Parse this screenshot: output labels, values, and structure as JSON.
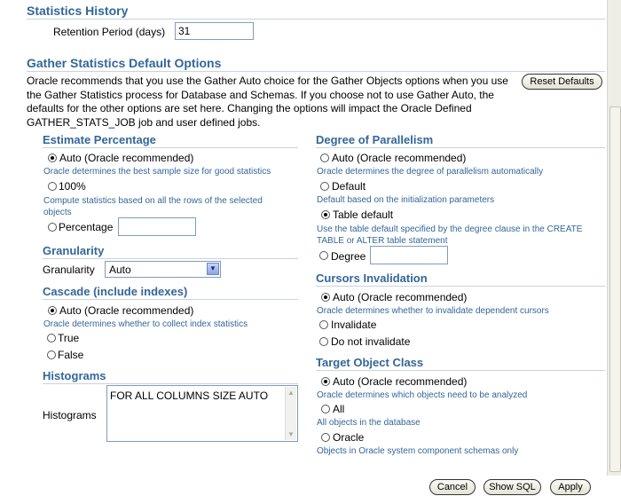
{
  "stats_history": {
    "title": "Statistics History",
    "retention_label": "Retention Period (days)",
    "retention_value": "31"
  },
  "gather_defaults": {
    "title": "Gather Statistics Default Options",
    "description_lines": [
      "Oracle recommends that you use the Gather Auto choice for the Gather Objects options when you use",
      "the Gather Statistics process for Database and Schemas. If you choose not to use Gather Auto, the",
      "defaults for the other options are set here. Changing the options will impact the Oracle Defined",
      "GATHER_STATS_JOB job and user defined jobs."
    ],
    "reset_button": "Reset Defaults"
  },
  "estimate": {
    "title": "Estimate Percentage",
    "auto_label": "Auto (Oracle recommended)",
    "auto_desc": "Oracle determines the best sample size for good statistics",
    "full_label": "100%",
    "full_desc_lines": [
      "Compute statistics based on all the rows of the selected",
      "objects"
    ],
    "pct_label": "Percentage",
    "pct_value": ""
  },
  "granularity": {
    "title": "Granularity",
    "label": "Granularity",
    "value": "Auto"
  },
  "cascade": {
    "title": "Cascade (include indexes)",
    "auto_label": "Auto (Oracle recommended)",
    "auto_desc": "Oracle determines whether to collect index statistics",
    "true_label": "True",
    "false_label": "False"
  },
  "histograms": {
    "title": "Histograms",
    "label": "Histograms",
    "value": "FOR ALL COLUMNS SIZE AUTO"
  },
  "parallelism": {
    "title": "Degree of Parallelism",
    "auto_label": "Auto (Oracle recommended)",
    "auto_desc": "Oracle determines the degree of parallelism automatically",
    "default_label": "Default",
    "default_desc": "Default based on the initialization parameters",
    "table_label": "Table default",
    "table_desc_lines": [
      "Use the table default specified by the degree clause in the CREATE",
      "TABLE or ALTER table statement"
    ],
    "degree_label": "Degree",
    "degree_value": ""
  },
  "cursors": {
    "title": "Cursors Invalidation",
    "auto_label": "Auto (Oracle recommended)",
    "auto_desc": "Oracle determines whether to invalidate dependent cursors",
    "invalidate_label": "Invalidate",
    "noinvalidate_label": "Do not invalidate"
  },
  "target": {
    "title": "Target Object Class",
    "auto_label": "Auto (Oracle recommended)",
    "auto_desc": "Oracle determines which objects need to be analyzed",
    "all_label": "All",
    "all_desc": "All objects in the database",
    "oracle_label": "Oracle",
    "oracle_desc": "Objects in Oracle system component schemas only"
  },
  "footer": {
    "cancel": "Cancel",
    "show_sql": "Show SQL",
    "apply": "Apply"
  },
  "colors": {
    "heading": "#336699",
    "divider": "#c9d3df"
  }
}
